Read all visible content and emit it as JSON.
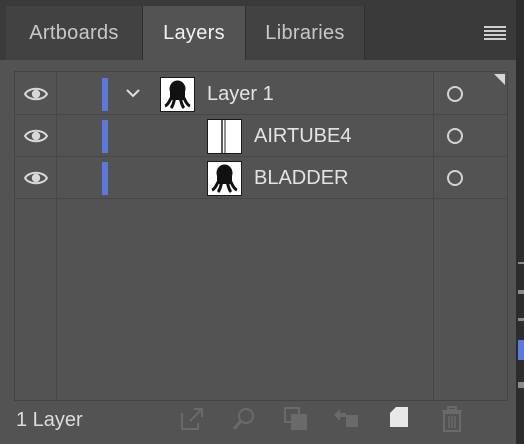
{
  "tabs": [
    {
      "label": "Artboards",
      "active": false
    },
    {
      "label": "Layers",
      "active": true
    },
    {
      "label": "Libraries",
      "active": false
    }
  ],
  "panel_menu_icon": "hamburger-icon",
  "layers": [
    {
      "name": "Layer 1",
      "visible": true,
      "expanded": true,
      "color": "#5b78da",
      "thumbnail": "octopus-silhouette",
      "indent": 0
    },
    {
      "name": "AIRTUBE4",
      "visible": true,
      "color": "#5b78da",
      "thumbnail": "tube-lines",
      "indent": 1
    },
    {
      "name": "BLADDER",
      "visible": true,
      "color": "#5b78da",
      "thumbnail": "octopus-silhouette",
      "indent": 1
    }
  ],
  "footer": {
    "count_label": "1 Layer",
    "icons": [
      "export-icon",
      "search-icon",
      "clipping-mask-icon",
      "move-selection-icon",
      "new-layer-icon",
      "trash-icon"
    ]
  },
  "colors": {
    "panel_bg": "#535353",
    "tabbar_bg": "#3a3a3a",
    "layer_color": "#5b78da"
  }
}
